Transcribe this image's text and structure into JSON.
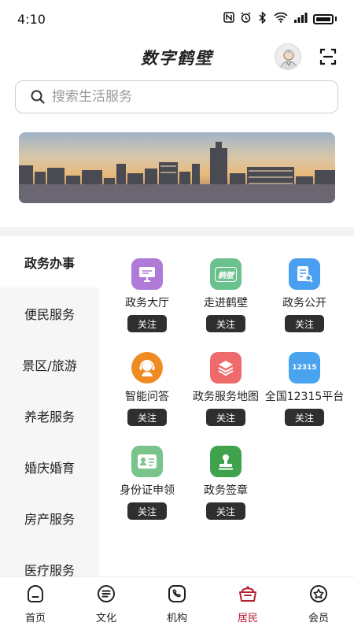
{
  "status_bar": {
    "time": "4:10"
  },
  "header": {
    "title": "数字鹤壁"
  },
  "search": {
    "placeholder": "搜索生活服务"
  },
  "sidebar": {
    "items": [
      {
        "label": "政务办事",
        "active": true
      },
      {
        "label": "便民服务",
        "active": false
      },
      {
        "label": "景区/旅游",
        "active": false
      },
      {
        "label": "养老服务",
        "active": false
      },
      {
        "label": "婚庆婚育",
        "active": false
      },
      {
        "label": "房产服务",
        "active": false
      },
      {
        "label": "医疗服务",
        "active": false
      }
    ]
  },
  "services": {
    "follow_label": "关注",
    "items": [
      {
        "label": "政务大厅",
        "icon": "hall-monitor-icon",
        "color": "#b07ad9"
      },
      {
        "label": "走进鹤壁",
        "icon": "hebi-badge-icon",
        "color": "#6cc28e",
        "badge_text": "鹤壁"
      },
      {
        "label": "政务公开",
        "icon": "document-search-icon",
        "color": "#4a9ff0"
      },
      {
        "label": "智能问答",
        "icon": "customer-service-icon",
        "color": "#f08a22"
      },
      {
        "label": "政务服务地图",
        "icon": "layers-map-icon",
        "color": "#ef6a6a"
      },
      {
        "label": "全国12315平台",
        "icon": "hotline-12315-icon",
        "color": "#4aa3ee",
        "badge_text": "12315"
      },
      {
        "label": "身份证申领",
        "icon": "id-card-icon",
        "color": "#79c48a"
      },
      {
        "label": "政务签章",
        "icon": "stamp-icon",
        "color": "#3fa34d"
      }
    ]
  },
  "bottom_nav": {
    "items": [
      {
        "label": "首页",
        "active": false
      },
      {
        "label": "文化",
        "active": false
      },
      {
        "label": "机构",
        "active": false
      },
      {
        "label": "居民",
        "active": true
      },
      {
        "label": "会员",
        "active": false
      }
    ]
  },
  "colors": {
    "accent": "#b3202e",
    "button_dark": "#2f2f2f",
    "sidebar_bg": "#f6f6f6"
  }
}
